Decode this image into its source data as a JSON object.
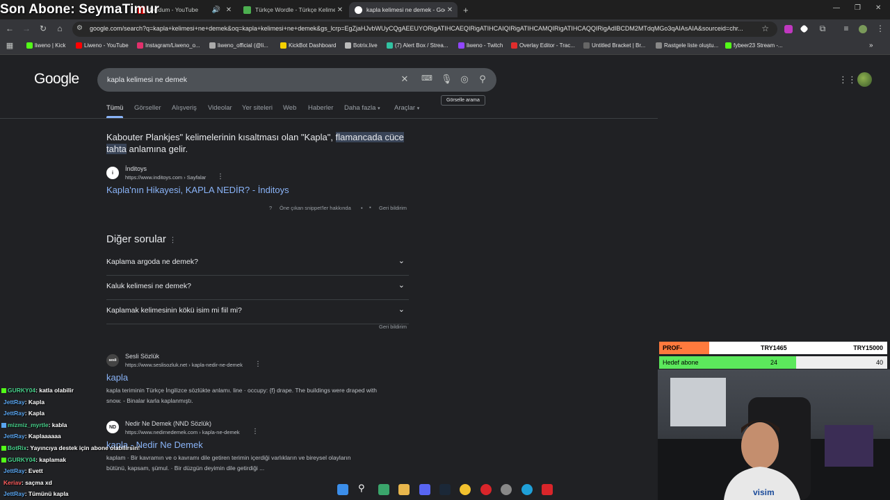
{
  "overlay_title": "Son Abone: SeymaTimur",
  "tabs": [
    {
      "label": "Doldum - YouTube",
      "color": "#ff0000",
      "active": false
    },
    {
      "label": "Türkçe Wordle - Türkçe Kelime",
      "color": "#4caf50",
      "active": false
    },
    {
      "label": "kapla kelimesi ne demek - Google",
      "color": "#4285f4",
      "active": true
    }
  ],
  "new_tab": "+",
  "address_bar": {
    "url": "google.com/search?q=kapla+kelimesi+ne+demek&oq=kapla+kelimesi+ne+demek&gs_lcrp=EgZjaHJvbWUyCQgAEEUYORigATIHCAEQIRigATIHCAIQIRigATIHCAMQIRigATIHCAQQIRigAdIBCDM2MTdqMGo3qAIAsAIA&sourceid=chr..."
  },
  "bookmarks": [
    {
      "label": "liweno | Kick",
      "color": "#53fc18"
    },
    {
      "label": "Liweno - YouTube",
      "color": "#ff0000"
    },
    {
      "label": "Instagram/Liweno_o...",
      "color": "#e1306c"
    },
    {
      "label": "liweno_official (@li...",
      "color": "#aaaaaa"
    },
    {
      "label": "KickBot Dashboard",
      "color": "#f5d000"
    },
    {
      "label": "Botrix.live",
      "color": "#bbbbbb"
    },
    {
      "label": "(7) Alert Box / Strea...",
      "color": "#31c3a2"
    },
    {
      "label": "liweno - Twitch",
      "color": "#9146ff"
    },
    {
      "label": "Overlay Editor - Trac...",
      "color": "#e02d2d"
    },
    {
      "label": "Untitled Bracket | Br...",
      "color": "#666666"
    },
    {
      "label": "Rastgele liste oluştu...",
      "color": "#888888"
    },
    {
      "label": "fybeer23 Stream -...",
      "color": "#53fc18"
    }
  ],
  "google": {
    "logo": "Google",
    "query": "kapla kelimesi ne demek",
    "tooltip": "Görselle arama",
    "search_tabs": [
      "Tümü",
      "Görseller",
      "Alışveriş",
      "Videolar",
      "Yer siteleri",
      "Web",
      "Haberler",
      "Daha fazla",
      "Araçlar"
    ],
    "snippet": {
      "text_before": "Kabouter Plankjes\" kelimelerinin kısaltması olan \"Kapla\", ",
      "highlight": "flamancada cüce tahta",
      "text_after": " anlamına gelir.",
      "source_name": "İnditoys",
      "source_url": "https://www.inditoys.com › Sayfalar",
      "link": "Kapla'nın Hikayesi, KAPLA NEDİR? - İnditoys",
      "about": "Öne çıkan snippet'ler hakkında",
      "feedback": "Geri bildirim"
    },
    "paa_title": "Diğer sorular",
    "paa": [
      "Kaplama argoda ne demek?",
      "Kaluk kelimesi ne demek?",
      "Kaplamak kelimesinin kökü isim mi fiil mi?"
    ],
    "paa_feedback": "Geri bildirim",
    "results": [
      {
        "source": "Sesli Sözlük",
        "url": "https://www.seslisozluk.net › kapla-nedir-ne-demek",
        "title": "kapla",
        "desc1": "kapla teriminin Türkçe İngilizce sözlükte anlamı. line · occupy: {f} drape. The buildings were draped with",
        "desc2": "snow. - Binalar karla kaplanmıştı."
      },
      {
        "source": "Nedir Ne Demek (NND Sözlük)",
        "url": "https://www.nedirnedemek.com › kapla-ne-demek",
        "title": "kapla - Nedir Ne Demek",
        "desc1": "kaplam · Bir kavramın ve o kavramı dile getiren terimin içerdiği varlıkların ve bireysel olayların",
        "desc2": "bütünü, kapsam, şümul. · Bir düzgün deyimin dile getirdiği ..."
      }
    ]
  },
  "chat": [
    {
      "user": "GURKY04",
      "msg": ": katla olabilir"
    },
    {
      "user": "JettRay",
      "msg": ": Kapla"
    },
    {
      "user": "JettRay",
      "msg": ": Kapla"
    },
    {
      "user": "mizmiz_myrtle",
      "msg": ": kabla"
    },
    {
      "user": "JettRay",
      "msg": ": Kaplaaaaaa"
    },
    {
      "user": "BotRix",
      "msg": ": Yayıncıya destek için abone olabilirsin!"
    },
    {
      "user": "GURKY04",
      "msg": ": kaplamak"
    },
    {
      "user": "JettRay",
      "msg": ": Evett"
    },
    {
      "user": "Keriav",
      "msg": ": saçma xd"
    },
    {
      "user": "JettRay",
      "msg": ": Tümünü kapla"
    }
  ],
  "stream": {
    "prof_label": "PROF-KAMERA",
    "prof_mid": "TRY1465",
    "prof_right": "TRY15000",
    "goal_label": "Hedef abone",
    "goal_current": "24",
    "goal_target": "40",
    "goal_fraction": 0.6
  }
}
